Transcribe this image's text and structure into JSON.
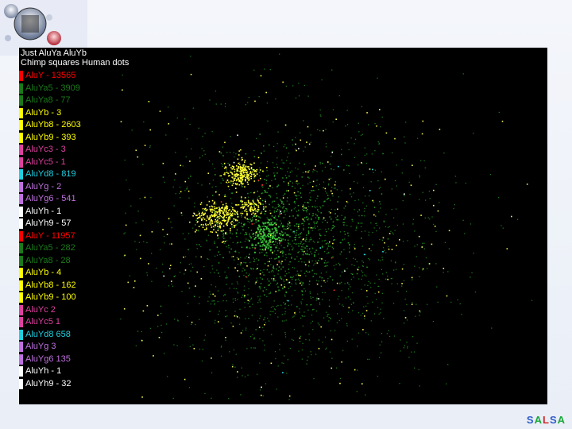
{
  "brand": {
    "letters": [
      {
        "ch": "S",
        "color": "#2f5cc8"
      },
      {
        "ch": "A",
        "color": "#1aa83a"
      },
      {
        "ch": "L",
        "color": "#d02c2c"
      },
      {
        "ch": "S",
        "color": "#2f5cc8"
      },
      {
        "ch": "A",
        "color": "#1aa83a"
      }
    ]
  },
  "chart_data": {
    "type": "scatter",
    "title": "Just AluYa AluYb",
    "subtitle": "Chimp squares Human dots",
    "xlabel": "",
    "ylabel": "",
    "grid": false,
    "legend_position": "left",
    "series": [
      {
        "name": "AluY - 13565",
        "color": "#ff0000"
      },
      {
        "name": "AluYa5 - 3909",
        "color": "#1a7a1a"
      },
      {
        "name": "AluYa8 - 77",
        "color": "#1a7a1a"
      },
      {
        "name": "AluYb - 3",
        "color": "#ffff00"
      },
      {
        "name": "AluYb8 - 2603",
        "color": "#ffff00"
      },
      {
        "name": "AluYb9 - 393",
        "color": "#ffff00"
      },
      {
        "name": "AluYc3 - 3",
        "color": "#e040a0"
      },
      {
        "name": "AluYc5 - 1",
        "color": "#e040a0"
      },
      {
        "name": "AluYd8 - 819",
        "color": "#20d0e0"
      },
      {
        "name": "AluYg - 2",
        "color": "#c070e0"
      },
      {
        "name": "AluYg6 - 541",
        "color": "#c070e0"
      },
      {
        "name": "AluYh - 1",
        "color": "#ffffff"
      },
      {
        "name": "AluYh9 - 57",
        "color": "#ffffff"
      },
      {
        "name": "AluY - 11957",
        "color": "#ff0000"
      },
      {
        "name": "AluYa5 - 282",
        "color": "#1a7a1a"
      },
      {
        "name": "AluYa8 - 28",
        "color": "#1a7a1a"
      },
      {
        "name": "AluYb - 4",
        "color": "#ffff00"
      },
      {
        "name": "AluYb8 - 162",
        "color": "#ffff00"
      },
      {
        "name": "AluYb9 - 100",
        "color": "#ffff00"
      },
      {
        "name": "AluYc 2",
        "color": "#e040a0"
      },
      {
        "name": "AluYc5 1",
        "color": "#e040a0"
      },
      {
        "name": "AluYd8 658",
        "color": "#20d0e0"
      },
      {
        "name": "AluYg 3",
        "color": "#c070e0"
      },
      {
        "name": "AluYg6 135",
        "color": "#c070e0"
      },
      {
        "name": "AluYh - 1",
        "color": "#ffffff"
      },
      {
        "name": "AluYh9 - 32",
        "color": "#ffffff"
      }
    ]
  }
}
